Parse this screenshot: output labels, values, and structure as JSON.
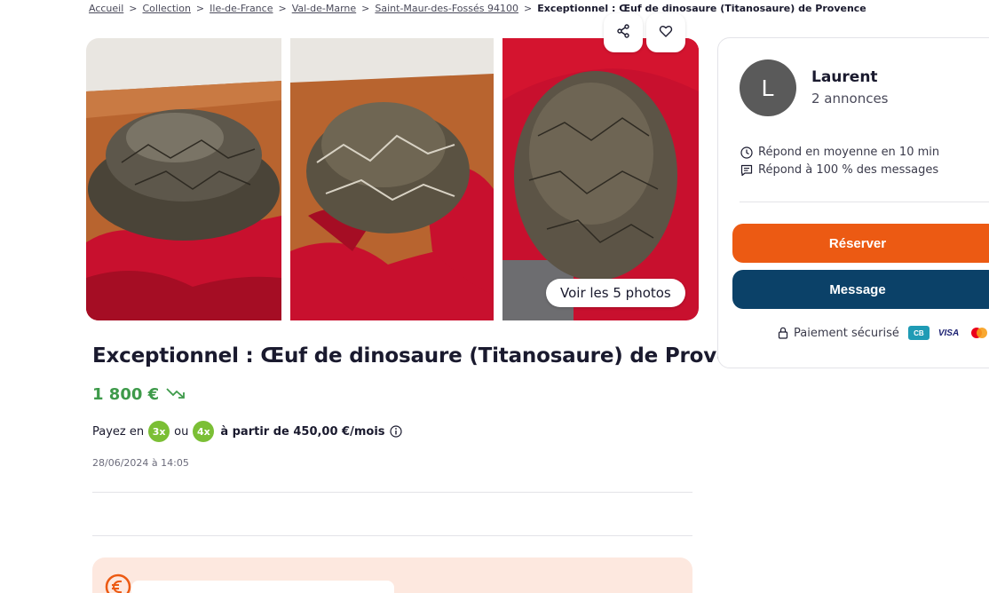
{
  "breadcrumb": {
    "items": [
      "Accueil",
      "Collection",
      "Ile-de-France",
      "Val-de-Marne",
      "Saint-Maur-des-Fossés 94100"
    ],
    "current": "Exceptionnel : Œuf de dinosaure (Titanosaure) de Provence",
    "separator": ">"
  },
  "gallery": {
    "see_all_label": "Voir les 5 photos",
    "share_icon": "share-icon",
    "favorite_icon": "heart-icon"
  },
  "listing": {
    "title": "Exceptionnel : Œuf de dinosaure (Titanosaure) de Provence",
    "price": "1 800 €",
    "price_trend_icon": "trending-down-icon",
    "payment": {
      "prefix": "Payez en",
      "option1": "3x",
      "connector": "ou",
      "option2": "4x",
      "detail": "à partir de 450,00 €/mois"
    },
    "date": "28/06/2024 à 14:05"
  },
  "seller": {
    "initial": "L",
    "name": "Laurent",
    "listings_count": "2 annonces",
    "response_time": "Répond en moyenne en 10 min",
    "response_rate": "Répond à 100 % des messages"
  },
  "actions": {
    "reserve_label": "Réserver",
    "message_label": "Message",
    "secure_label": "Paiement sécurisé",
    "cb_label": "CB",
    "visa_label": "VISA"
  },
  "colors": {
    "reserve": "#ec5a13",
    "message": "#0b4168",
    "price": "#3e9a4a",
    "installment_badge": "#7bbf35"
  }
}
